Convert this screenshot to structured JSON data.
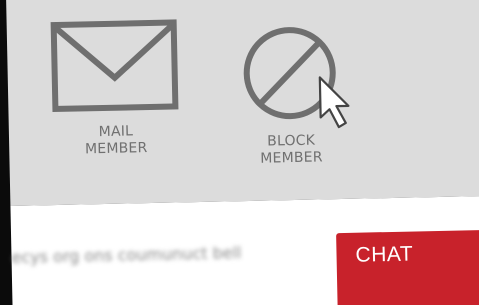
{
  "actions": {
    "mail": {
      "line1": "MAIL",
      "line2": "MEMBER",
      "icon": "mail-icon"
    },
    "block": {
      "line1": "BLOCK",
      "line2": "MEMBER",
      "icon": "block-icon"
    }
  },
  "chat": {
    "label": "CHAT"
  },
  "colors": {
    "toolbar_bg": "#dcdcdc",
    "icon_gray": "#707070",
    "chat_red": "#c8222b",
    "content_bg": "#ffffff"
  },
  "cursor": {
    "icon": "mouse-pointer-icon"
  }
}
